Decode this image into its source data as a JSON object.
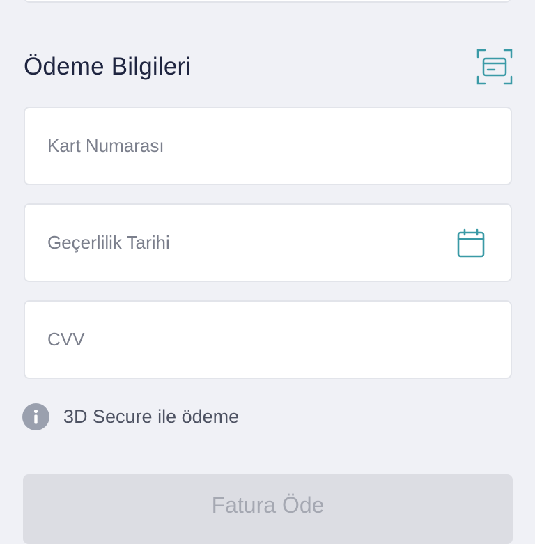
{
  "payment_section": {
    "title": "Ödeme Bilgileri",
    "scan_icon": "card-scan-icon"
  },
  "fields": {
    "card_number": {
      "placeholder": "Kart Numarası",
      "value": ""
    },
    "expiry": {
      "placeholder": "Geçerlilik Tarihi",
      "value": "",
      "icon": "calendar-icon"
    },
    "cvv": {
      "placeholder": "CVV",
      "value": ""
    }
  },
  "secure_note": {
    "icon": "info-icon",
    "text": "3D Secure ile ödeme"
  },
  "pay_button": {
    "label": "Fatura Öde",
    "enabled": false
  },
  "colors": {
    "background": "#f0f1f6",
    "accent": "#3a9aa6",
    "title": "#1f2540",
    "disabled_button": "#dcdde3"
  }
}
